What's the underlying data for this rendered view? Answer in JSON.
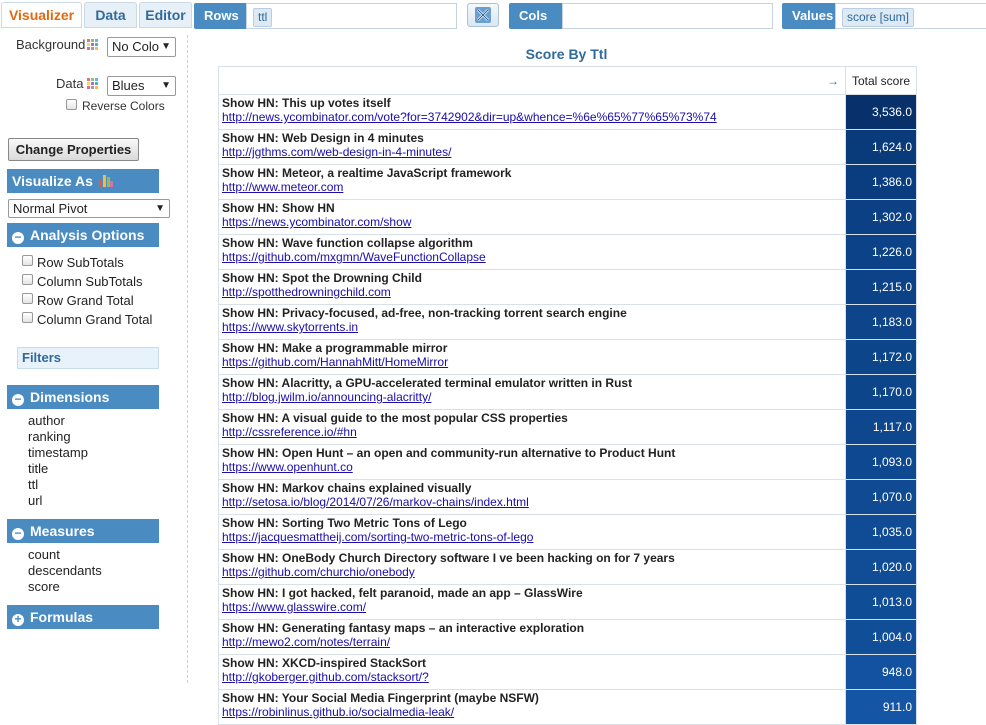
{
  "tabs": [
    {
      "label": "Visualizer",
      "active": true
    },
    {
      "label": "Data",
      "active": false
    },
    {
      "label": "Editor",
      "active": false
    }
  ],
  "toolbar": {
    "rows_label": "Rows",
    "rows_value": "ttl",
    "cols_label": "Cols",
    "cols_value": "",
    "values_label": "Values",
    "values_value": "score [sum]",
    "swap_icon": "swap-axes-icon"
  },
  "sidebar": {
    "background_label": "Background",
    "background_value": "No Colo",
    "data_label": "Data",
    "data_value": "Blues",
    "reverse_colors": "Reverse Colors",
    "change_properties": "Change Properties",
    "visualize_as": "Visualize As",
    "visualize_value": "Normal Pivot",
    "analysis_options": "Analysis Options",
    "options": [
      "Row SubTotals",
      "Column SubTotals",
      "Row Grand Total",
      "Column Grand Total"
    ],
    "filters": "Filters",
    "dimensions": "Dimensions",
    "dimension_items": [
      "author",
      "ranking",
      "timestamp",
      "title",
      "ttl",
      "url"
    ],
    "measures": "Measures",
    "measure_items": [
      "count",
      "descendants",
      "score"
    ],
    "formulas": "Formulas"
  },
  "pivot": {
    "title": "Score By Ttl",
    "corner_arrow": "→",
    "total_header": "Total score",
    "rows": [
      {
        "title": "Show HN: This up votes itself",
        "url": "http://news.ycombinator.com/vote?for=3742902&dir=up&whence=%6e%65%77%65%73%74",
        "value": "3,536.0",
        "color": "#08306b"
      },
      {
        "title": "Show HN: Web Design in 4 minutes",
        "url": "http://jgthms.com/web-design-in-4-minutes/",
        "value": "1,624.0",
        "color": "#093a7a"
      },
      {
        "title": "Show HN: Meteor, a realtime JavaScript framework",
        "url": "http://www.meteor.com",
        "value": "1,386.0",
        "color": "#0a3d80"
      },
      {
        "title": "Show HN: Show HN",
        "url": "https://news.ycombinator.com/show",
        "value": "1,302.0",
        "color": "#0b4084"
      },
      {
        "title": "Show HN: Wave function collapse algorithm",
        "url": "https://github.com/mxgmn/WaveFunctionCollapse",
        "value": "1,226.0",
        "color": "#0c4287"
      },
      {
        "title": "Show HN: Spot the Drowning Child",
        "url": "http://spotthedrowningchild.com",
        "value": "1,215.0",
        "color": "#0c4288"
      },
      {
        "title": "Show HN: Privacy-focused, ad-free, non-tracking torrent search engine",
        "url": "https://www.skytorrents.in",
        "value": "1,183.0",
        "color": "#0d448a"
      },
      {
        "title": "Show HN: Make a programmable mirror",
        "url": "https://github.com/HannahMitt/HomeMirror",
        "value": "1,172.0",
        "color": "#0d458b"
      },
      {
        "title": "Show HN: Alacritty, a GPU-accelerated terminal emulator written in Rust",
        "url": "http://blog.jwilm.io/announcing-alacritty/",
        "value": "1,170.0",
        "color": "#0d458b"
      },
      {
        "title": "Show HN: A visual guide to the most popular CSS properties",
        "url": "http://cssreference.io/#hn",
        "value": "1,117.0",
        "color": "#0e478e"
      },
      {
        "title": "Show HN: Open Hunt – an open and community-run alternative to Product Hunt",
        "url": "https://www.openhunt.co",
        "value": "1,093.0",
        "color": "#0e4890"
      },
      {
        "title": "Show HN: Markov chains explained visually",
        "url": "http://setosa.io/blog/2014/07/26/markov-chains/index.html",
        "value": "1,070.0",
        "color": "#0f4a92"
      },
      {
        "title": "Show HN: Sorting Two Metric Tons of Lego",
        "url": "https://jacquesmattheij.com/sorting-two-metric-tons-of-lego",
        "value": "1,035.0",
        "color": "#104c95"
      },
      {
        "title": "Show HN: OneBody Church Directory software I ve been hacking on for 7 years",
        "url": "https://github.com/churchio/onebody",
        "value": "1,020.0",
        "color": "#104d96"
      },
      {
        "title": "Show HN: I got hacked, felt paranoid, made an app – GlassWire",
        "url": "https://www.glasswire.com/",
        "value": "1,013.0",
        "color": "#104d97"
      },
      {
        "title": "Show HN: Generating fantasy maps – an interactive exploration",
        "url": "http://mewo2.com/notes/terrain/",
        "value": "1,004.0",
        "color": "#114e98"
      },
      {
        "title": "Show HN: XKCD-inspired StackSort",
        "url": "http://gkoberger.github.com/stacksort/?",
        "value": "948.0",
        "color": "#1352a0"
      },
      {
        "title": "Show HN: Your Social Media Fingerprint (maybe NSFW)",
        "url": "https://robinlinus.github.io/socialmedia-leak/",
        "value": "911.0",
        "color": "#1555a6"
      }
    ]
  }
}
